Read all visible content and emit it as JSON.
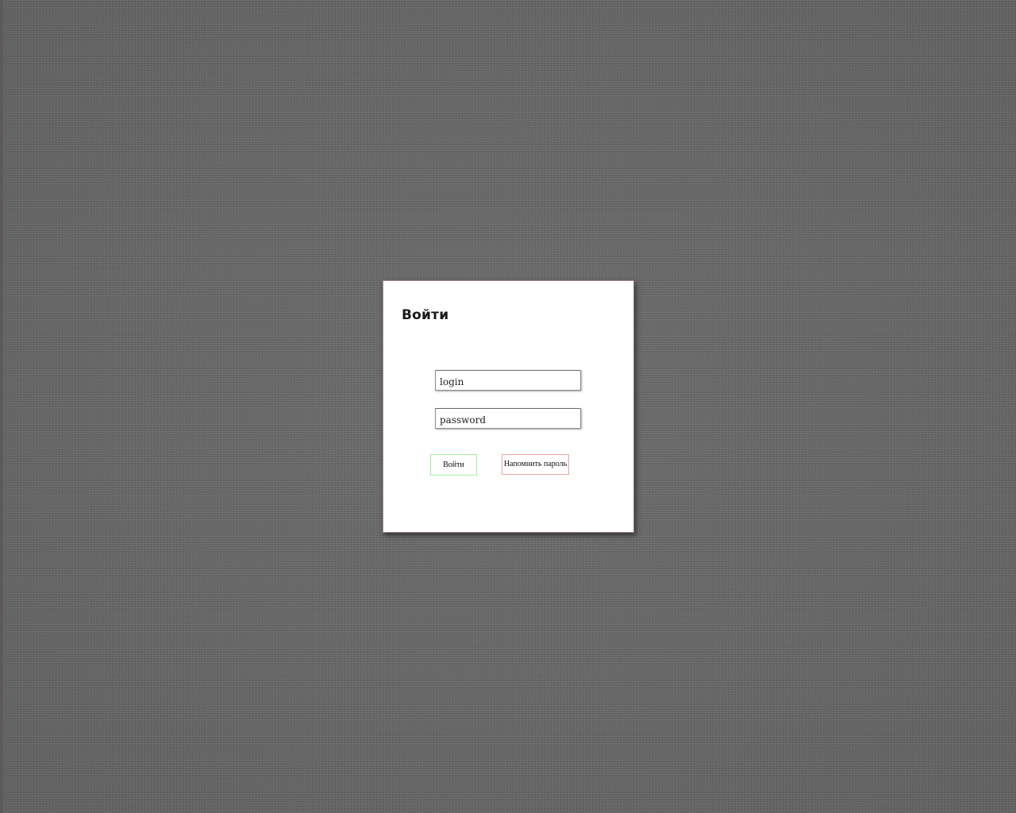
{
  "login_form": {
    "title": "Войти",
    "login_field": {
      "placeholder": "login",
      "value": ""
    },
    "password_field": {
      "placeholder": "password",
      "value": ""
    },
    "submit_label": "Войти",
    "remind_label": "Напомнить пароль"
  },
  "colors": {
    "background": "#6b6b6b",
    "panel": "#ffffff",
    "submit_border": "#9ef09e",
    "remind_border": "#f0a5a5"
  }
}
